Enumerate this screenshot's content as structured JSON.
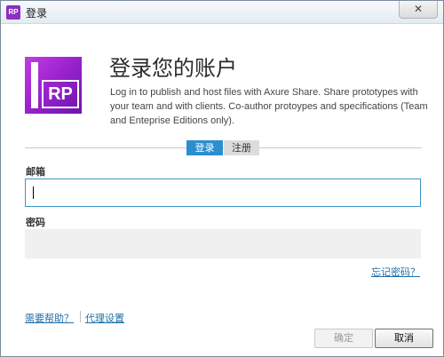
{
  "window": {
    "title": "登录",
    "app_icon_text": "RP",
    "close_glyph": "✕"
  },
  "logo": {
    "text": "RP"
  },
  "heading": "登录您的账户",
  "description": "Log in to publish and host files with Axure Share. Share prototypes with your team and with clients. Co-author protoypes and specifications (Team and Enteprise Editions only).",
  "tabs": [
    {
      "label": "登录",
      "active": true
    },
    {
      "label": "注册",
      "active": false
    }
  ],
  "email": {
    "label": "邮箱",
    "value": ""
  },
  "password": {
    "label": "密码",
    "value": ""
  },
  "links": {
    "forgot": "忘记密码？",
    "help": "需要帮助？",
    "proxy": "代理设置"
  },
  "buttons": {
    "ok": "确定",
    "cancel": "取消"
  },
  "colors": {
    "accent": "#2a8ecf",
    "logo_purple": "#9b23cf",
    "link": "#1f6fa8"
  }
}
